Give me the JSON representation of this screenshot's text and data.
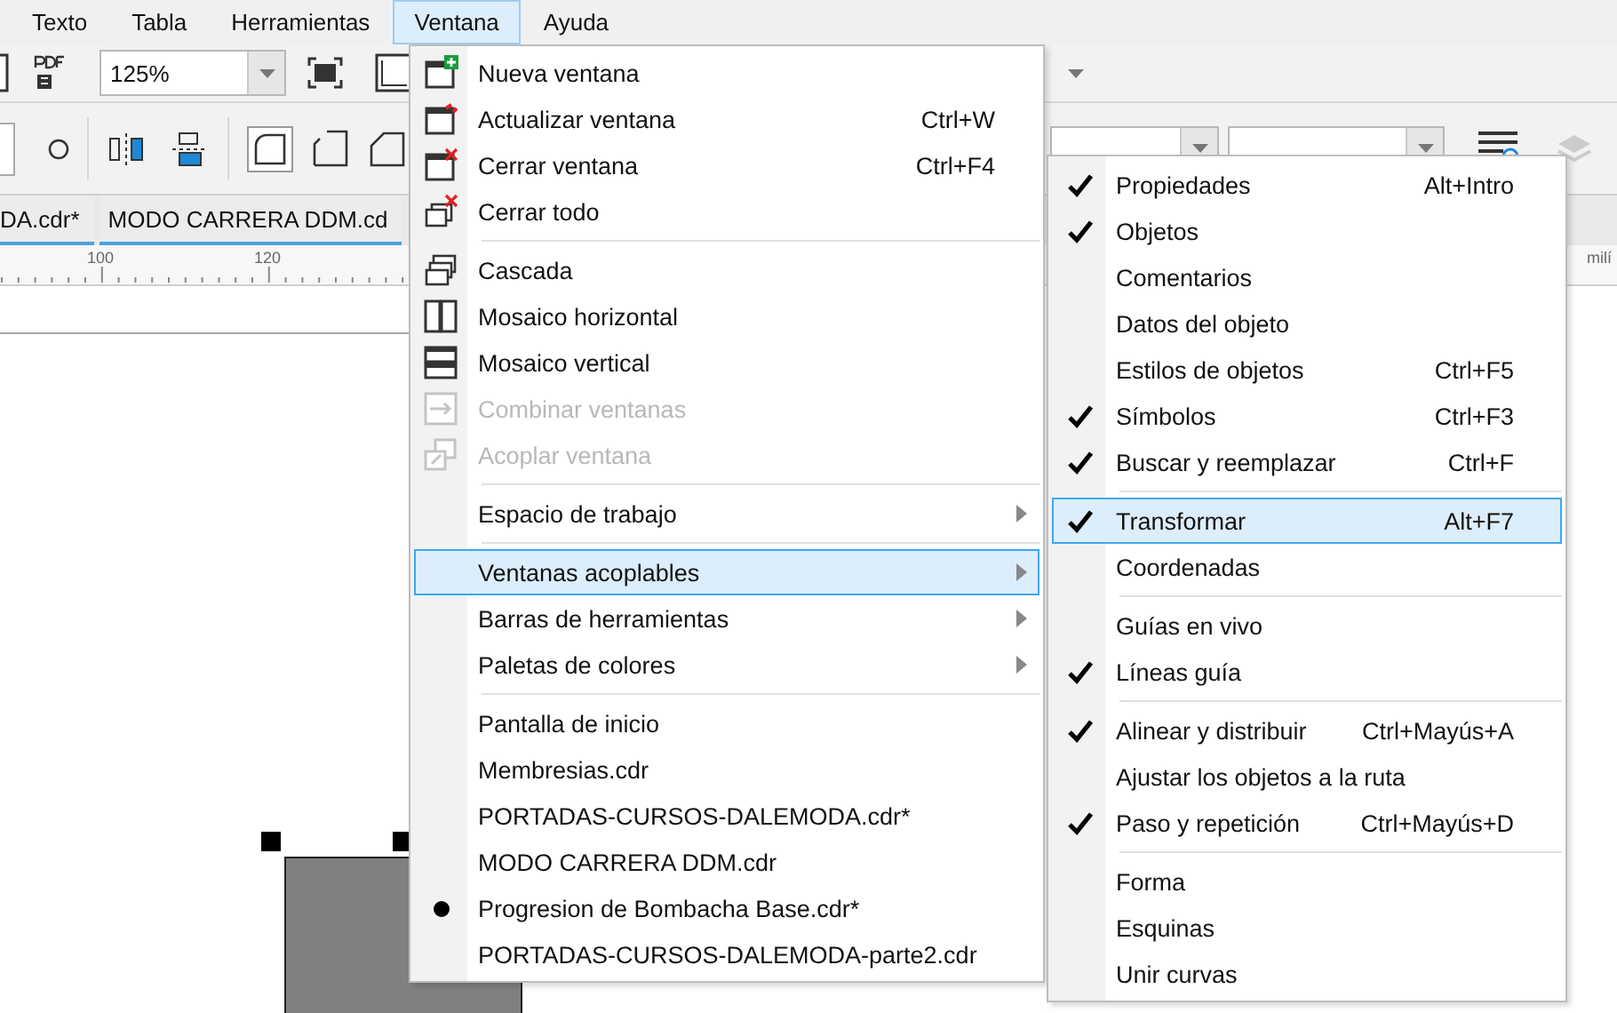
{
  "menubar": [
    {
      "label": "Texto",
      "selected": false
    },
    {
      "label": "Tabla",
      "selected": false
    },
    {
      "label": "Herramientas",
      "selected": false
    },
    {
      "label": "Ventana",
      "selected": true
    },
    {
      "label": "Ayuda",
      "selected": false
    }
  ],
  "toolbar": {
    "zoom": "125%"
  },
  "document_tabs": [
    {
      "label": "DA.cdr*"
    },
    {
      "label": "MODO CARRERA DDM.cd"
    }
  ],
  "ruler": {
    "labels": [
      "100",
      "120"
    ],
    "unit": "milí"
  },
  "window_menu": {
    "sections": [
      {
        "items": [
          {
            "label": "Nueva ventana",
            "selected": false,
            "disabled": false
          },
          {
            "label": "Actualizar ventana",
            "shortcut": "Ctrl+W",
            "selected": false,
            "disabled": false
          },
          {
            "label": "Cerrar ventana",
            "shortcut": "Ctrl+F4",
            "selected": false,
            "disabled": false
          },
          {
            "label": "Cerrar todo",
            "selected": false,
            "disabled": false
          }
        ]
      },
      {
        "items": [
          {
            "label": "Cascada",
            "selected": false,
            "disabled": false
          },
          {
            "label": "Mosaico horizontal",
            "selected": false,
            "disabled": false
          },
          {
            "label": "Mosaico vertical",
            "selected": false,
            "disabled": false
          },
          {
            "label": "Combinar ventanas",
            "selected": false,
            "disabled": true
          },
          {
            "label": "Acoplar ventana",
            "selected": false,
            "disabled": true
          }
        ]
      },
      {
        "items": [
          {
            "label": "Espacio de trabajo",
            "selected": false,
            "submenu": true
          }
        ]
      },
      {
        "items": [
          {
            "label": "Ventanas acoplables",
            "selected": true,
            "submenu": true
          },
          {
            "label": "Barras de herramientas",
            "selected": false,
            "submenu": true
          },
          {
            "label": "Paletas de colores",
            "selected": false,
            "submenu": true
          }
        ]
      },
      {
        "items": [
          {
            "label": "Pantalla de inicio",
            "selected": false,
            "current": false
          },
          {
            "label": "Membresias.cdr",
            "selected": false,
            "current": false
          },
          {
            "label": "PORTADAS-CURSOS-DALEMODA.cdr*",
            "selected": false,
            "current": false
          },
          {
            "label": "MODO CARRERA DDM.cdr",
            "selected": false,
            "current": false
          },
          {
            "label": "Progresion de Bombacha Base.cdr*",
            "selected": false,
            "current": true
          },
          {
            "label": "PORTADAS-CURSOS-DALEMODA-parte2.cdr",
            "selected": false,
            "current": false
          }
        ]
      }
    ]
  },
  "dockers_submenu": {
    "sections": [
      {
        "items": [
          {
            "label": "Propiedades",
            "shortcut": "Alt+Intro",
            "checked": true,
            "selected": false
          },
          {
            "label": "Objetos",
            "checked": true,
            "selected": false
          },
          {
            "label": "Comentarios",
            "checked": false,
            "selected": false
          },
          {
            "label": "Datos del objeto",
            "checked": false,
            "selected": false
          },
          {
            "label": "Estilos de objetos",
            "shortcut": "Ctrl+F5",
            "checked": false,
            "selected": false
          },
          {
            "label": "Símbolos",
            "shortcut": "Ctrl+F3",
            "checked": true,
            "selected": false
          },
          {
            "label": "Buscar y reemplazar",
            "shortcut": "Ctrl+F",
            "checked": true,
            "selected": false
          }
        ]
      },
      {
        "items": [
          {
            "label": "Transformar",
            "shortcut": "Alt+F7",
            "checked": true,
            "selected": true
          },
          {
            "label": "Coordenadas",
            "checked": false,
            "selected": false
          }
        ]
      },
      {
        "items": [
          {
            "label": "Guías en vivo",
            "checked": false,
            "selected": false
          },
          {
            "label": "Líneas guía",
            "checked": true,
            "selected": false
          }
        ]
      },
      {
        "items": [
          {
            "label": "Alinear y distribuir",
            "shortcut": "Ctrl+Mayús+A",
            "checked": true,
            "selected": false
          },
          {
            "label": "Ajustar los objetos a la ruta",
            "checked": false,
            "selected": false
          },
          {
            "label": "Paso y repetición",
            "shortcut": "Ctrl+Mayús+D",
            "checked": true,
            "selected": false
          }
        ]
      },
      {
        "items": [
          {
            "label": "Forma",
            "checked": false,
            "selected": false
          },
          {
            "label": "Esquinas",
            "checked": false,
            "selected": false
          },
          {
            "label": "Unir curvas",
            "checked": false,
            "selected": false
          }
        ]
      }
    ]
  }
}
